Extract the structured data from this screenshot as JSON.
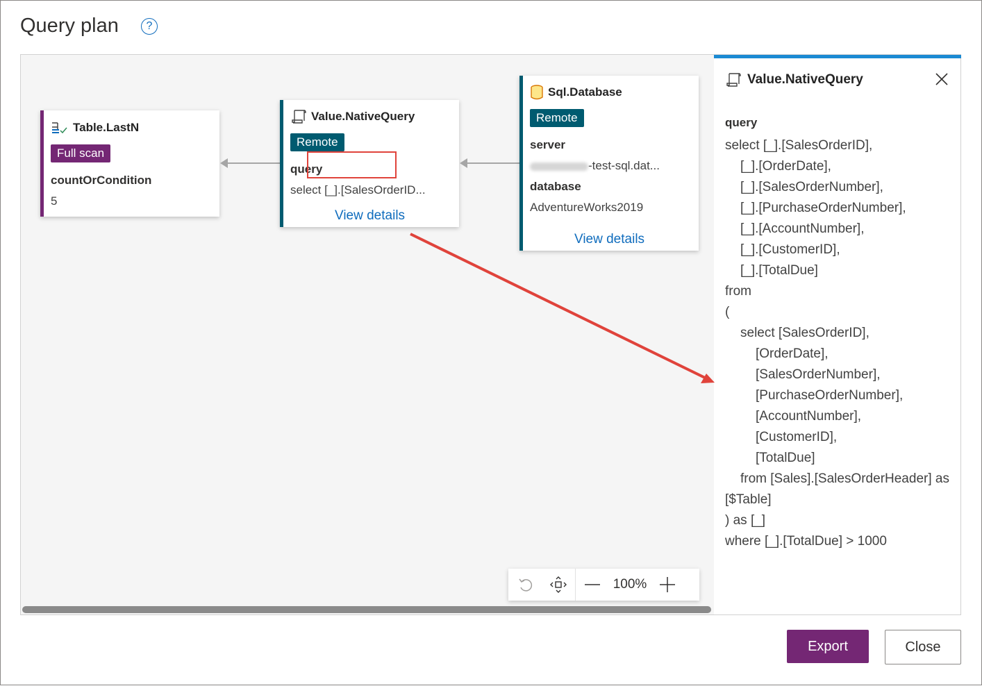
{
  "dialog": {
    "title": "Query plan",
    "help_symbol": "?"
  },
  "nodes": {
    "lastn": {
      "title": "Table.LastN",
      "badge": "Full scan",
      "param_label": "countOrCondition",
      "param_value": "5",
      "accent": "#742774"
    },
    "nativequery": {
      "title": "Value.NativeQuery",
      "badge": "Remote",
      "param_label": "query",
      "param_value": "select [_].[SalesOrderID...",
      "link": "View details",
      "accent": "#005b70"
    },
    "sqldb": {
      "title": "Sql.Database",
      "badge": "Remote",
      "server_label": "server",
      "server_value": "-test-sql.dat...",
      "database_label": "database",
      "database_value": "AdventureWorks2019",
      "link": "View details",
      "accent": "#005b70"
    }
  },
  "zoom": {
    "percent": "100%"
  },
  "panel": {
    "title": "Value.NativeQuery",
    "param_label": "query",
    "code_lines": [
      "select [_].[SalesOrderID],",
      "    [_].[OrderDate],",
      "    [_].[SalesOrderNumber],",
      "    [_].[PurchaseOrderNumber],",
      "    [_].[AccountNumber],",
      "    [_].[CustomerID],",
      "    [_].[TotalDue]",
      "from",
      "(",
      "    select [SalesOrderID],",
      "        [OrderDate],",
      "        [SalesOrderNumber],",
      "        [PurchaseOrderNumber],",
      "        [AccountNumber],",
      "        [CustomerID],",
      "        [TotalDue]",
      "    from [Sales].[SalesOrderHeader] as",
      "[$Table]",
      ") as [_]",
      "where [_].[TotalDue] > 1000"
    ]
  },
  "footer": {
    "export_label": "Export",
    "close_label": "Close"
  },
  "colors": {
    "primary": "#742774",
    "remote_badge": "#005b70",
    "link": "#0f6cbd",
    "highlight": "#e0433b",
    "panel_topbar": "#1b8ad3"
  },
  "icons": [
    "help-icon",
    "table-lastn-icon",
    "script-icon",
    "database-icon",
    "close-icon",
    "reset-icon",
    "fit-view-icon",
    "zoom-out-icon",
    "zoom-in-icon"
  ]
}
